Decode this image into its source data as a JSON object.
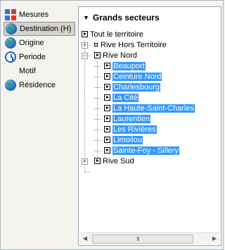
{
  "sidebar": {
    "items": [
      {
        "label": "Mesures",
        "icon": "grid-icon",
        "selected": false
      },
      {
        "label": "Destination (H)",
        "icon": "globe-icon",
        "selected": true
      },
      {
        "label": "Origine",
        "icon": "globe-icon",
        "selected": false
      },
      {
        "label": "Periode",
        "icon": "clock-icon",
        "selected": false
      },
      {
        "label": "Motif",
        "icon": "",
        "selected": false
      },
      {
        "label": "Résidence",
        "icon": "globe-icon",
        "selected": false
      }
    ]
  },
  "panel": {
    "title": "Grands secteurs",
    "tree": {
      "root": "Tout le territoire",
      "rive_hors": "Rive Hors Territoire",
      "rive_nord": "Rive Nord",
      "rive_nord_children": [
        "Beauport",
        "Ceinture Nord",
        "Charlesbourg",
        "La Cité",
        "La Haute-Saint-Charles",
        "Laurentien",
        "Les Rivières",
        "Limoilou",
        "Sainte-Foy - Sillery"
      ],
      "rive_sud": "Rive Sud"
    },
    "scrollbar": {
      "grip": "III",
      "left_arrow": "◀",
      "right_arrow": "▶"
    }
  },
  "colors": {
    "selection": "#3399ff",
    "background": "#f4f3ee"
  }
}
